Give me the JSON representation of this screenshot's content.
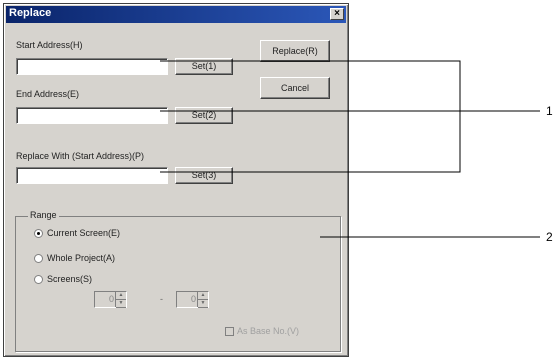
{
  "window": {
    "title": "Replace",
    "close_glyph": "×"
  },
  "start_address": {
    "label": "Start Address(H)",
    "value": "",
    "set_label": "Set(1)"
  },
  "end_address": {
    "label": "End Address(E)",
    "value": "",
    "set_label": "Set(2)"
  },
  "replace_with": {
    "label": "Replace With (Start Address)(P)",
    "value": "",
    "set_label": "Set(3)"
  },
  "buttons": {
    "replace": "Replace(R)",
    "cancel": "Cancel"
  },
  "range": {
    "title": "Range",
    "options": [
      {
        "label": "Current Screen(E)",
        "selected": true
      },
      {
        "label": "Whole Project(A)",
        "selected": false
      },
      {
        "label": "Screens(S)",
        "selected": false
      }
    ],
    "from_value": "0",
    "dash": "-",
    "to_value": "0",
    "checkbox_label": "As Base No.(V)"
  },
  "callouts": [
    "1",
    "2"
  ]
}
